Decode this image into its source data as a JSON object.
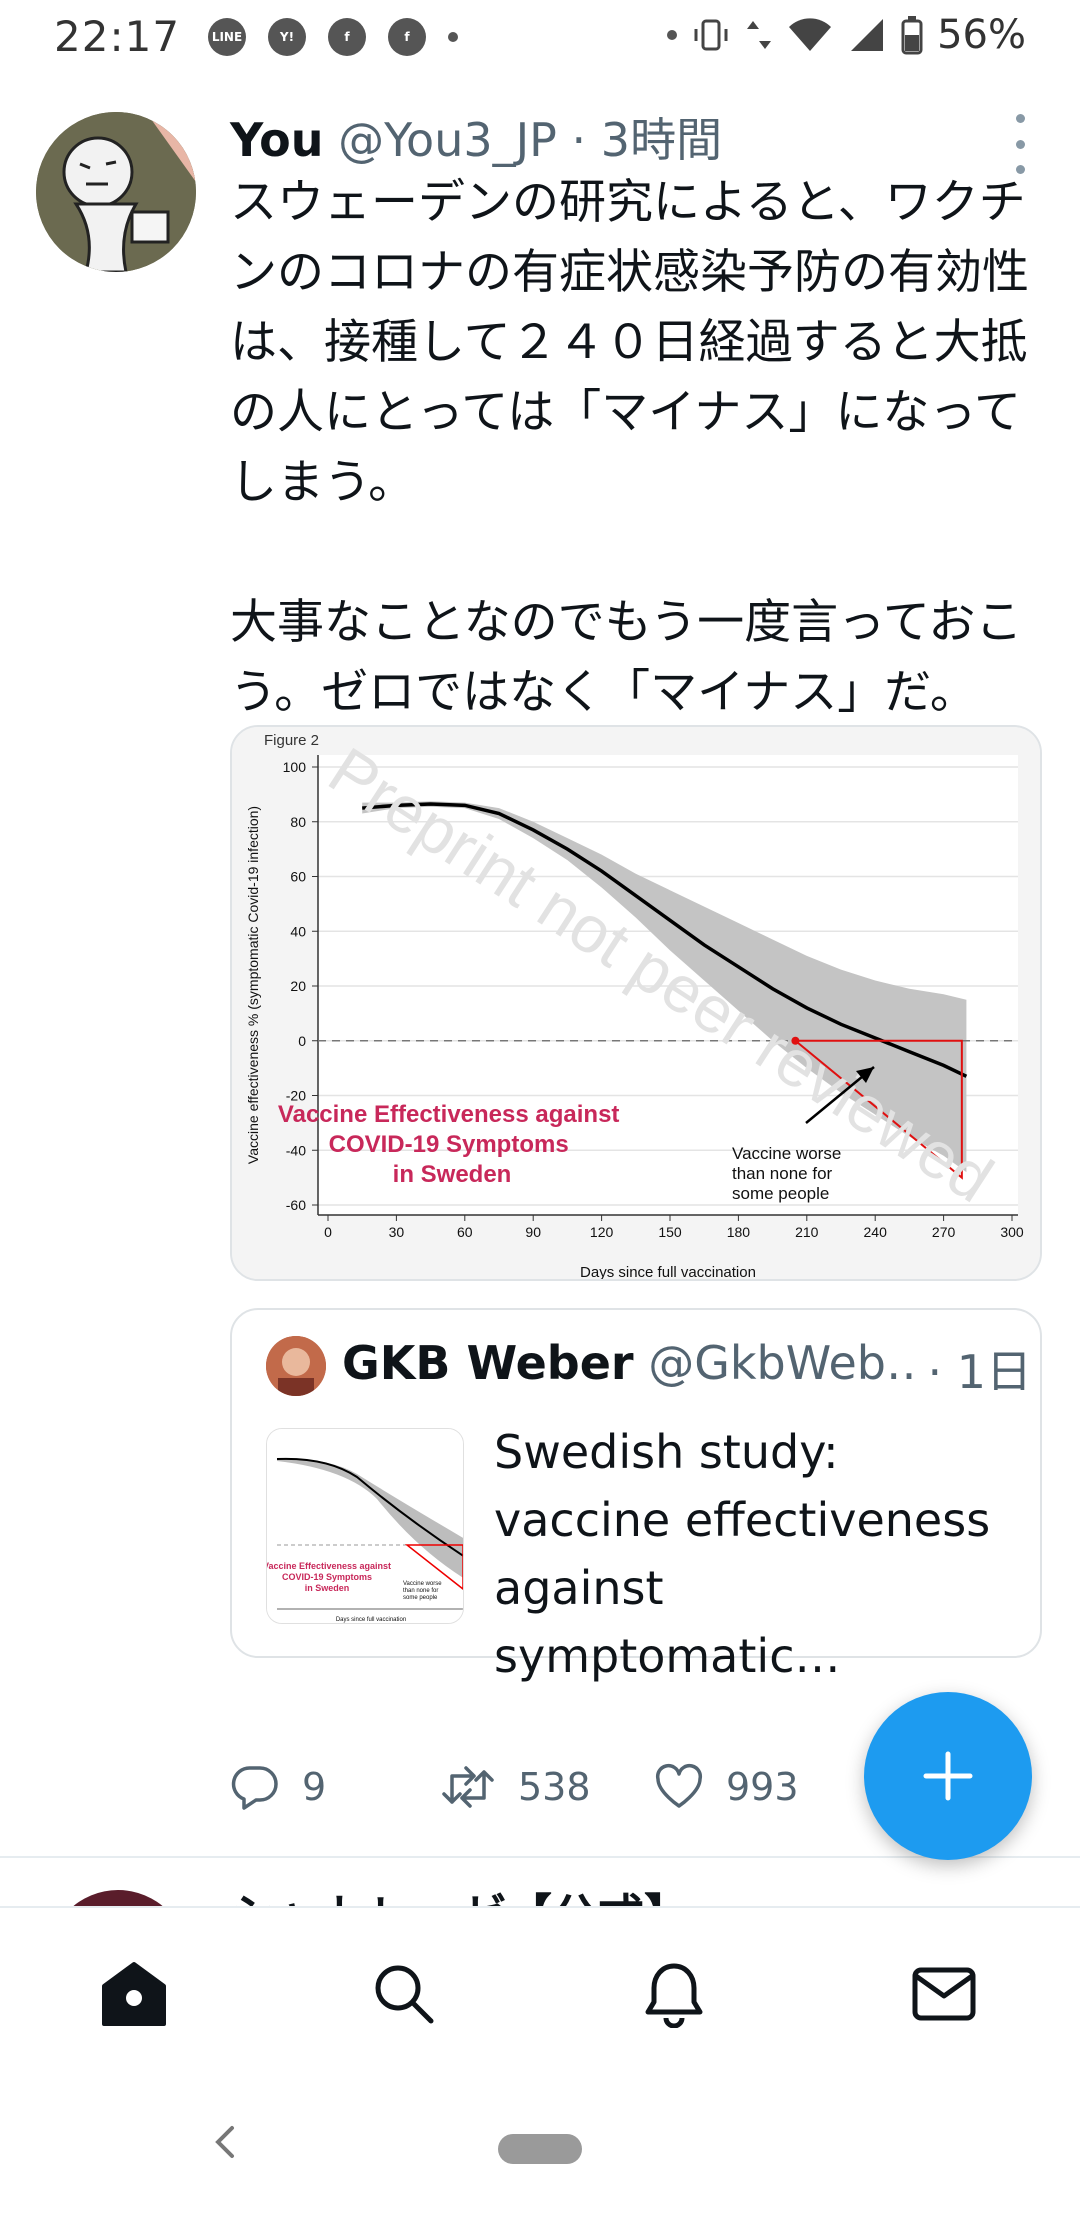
{
  "status_bar": {
    "time": "22:17",
    "apps": [
      "LINE",
      "Y!",
      "f",
      "f"
    ],
    "battery": "56%",
    "icons": [
      "vibrate-icon",
      "data-icon",
      "wifi-icon",
      "signal-icon",
      "battery-icon"
    ]
  },
  "tweet": {
    "author_name": "You",
    "author_handle": "@You3_JP",
    "separator": "·",
    "time": "3時間",
    "text": "スウェーデンの研究によると、ワクチンのコロナの有症状感染予防の有効性は、接種して２４０日経過すると大抵の人にとっては「マイナス」になってしまう。\n\n大事なことなのでもう一度言っておこう。ゼロではなく「マイナス」だ。",
    "counts": {
      "replies": "9",
      "retweets": "538",
      "likes": "993"
    }
  },
  "quote": {
    "author_name": "GKB Weber",
    "author_handle": "@GkbWeb…",
    "time": "· 1日",
    "text": "Swedish study: vaccine effectiveness against symptomatic…"
  },
  "next_tweet": {
    "header": "シャトレーゼ【公式】"
  },
  "chart_data": {
    "type": "line",
    "title": "Figure 2",
    "xlabel": "Days since full vaccination",
    "ylabel": "Vaccine effectiveness % (symptomatic Covid-19 infection)",
    "xlim": [
      0,
      300
    ],
    "ylim": [
      -60,
      100
    ],
    "x_ticks": [
      0,
      30,
      60,
      90,
      120,
      150,
      180,
      210,
      240,
      270,
      300
    ],
    "y_ticks": [
      100,
      80,
      60,
      40,
      20,
      0,
      -20,
      -40,
      -60
    ],
    "grid": true,
    "series": [
      {
        "x": [
          15,
          30,
          45,
          60,
          75,
          90,
          105,
          120,
          135,
          150,
          165,
          180,
          195,
          210,
          225,
          240,
          255,
          270,
          280
        ],
        "values": [
          85,
          86,
          86.5,
          86,
          83,
          77,
          70,
          62,
          53,
          44,
          35,
          27,
          19,
          12,
          6,
          1,
          -4,
          -9,
          -13
        ],
        "ci_lower": [
          83,
          85,
          85.5,
          85,
          81,
          74,
          66,
          56,
          45,
          33,
          22,
          11,
          0,
          -10,
          -19,
          -27,
          -35,
          -42,
          -48
        ],
        "ci_upper": [
          87,
          87,
          87.5,
          87,
          85,
          80,
          74,
          68,
          61,
          55,
          49,
          43,
          37,
          31,
          26,
          22,
          19,
          17,
          15
        ]
      }
    ],
    "reference_line": 0,
    "annotations": [
      {
        "text": "Vaccine Effectiveness  against COVID-19 Symptoms in Sweden",
        "color": "#c8285a"
      },
      {
        "text": "Vaccine worse than none for some people",
        "color": "#000000"
      },
      {
        "text": "Preprint not peer reviewed",
        "color": "#dddddd"
      }
    ]
  }
}
